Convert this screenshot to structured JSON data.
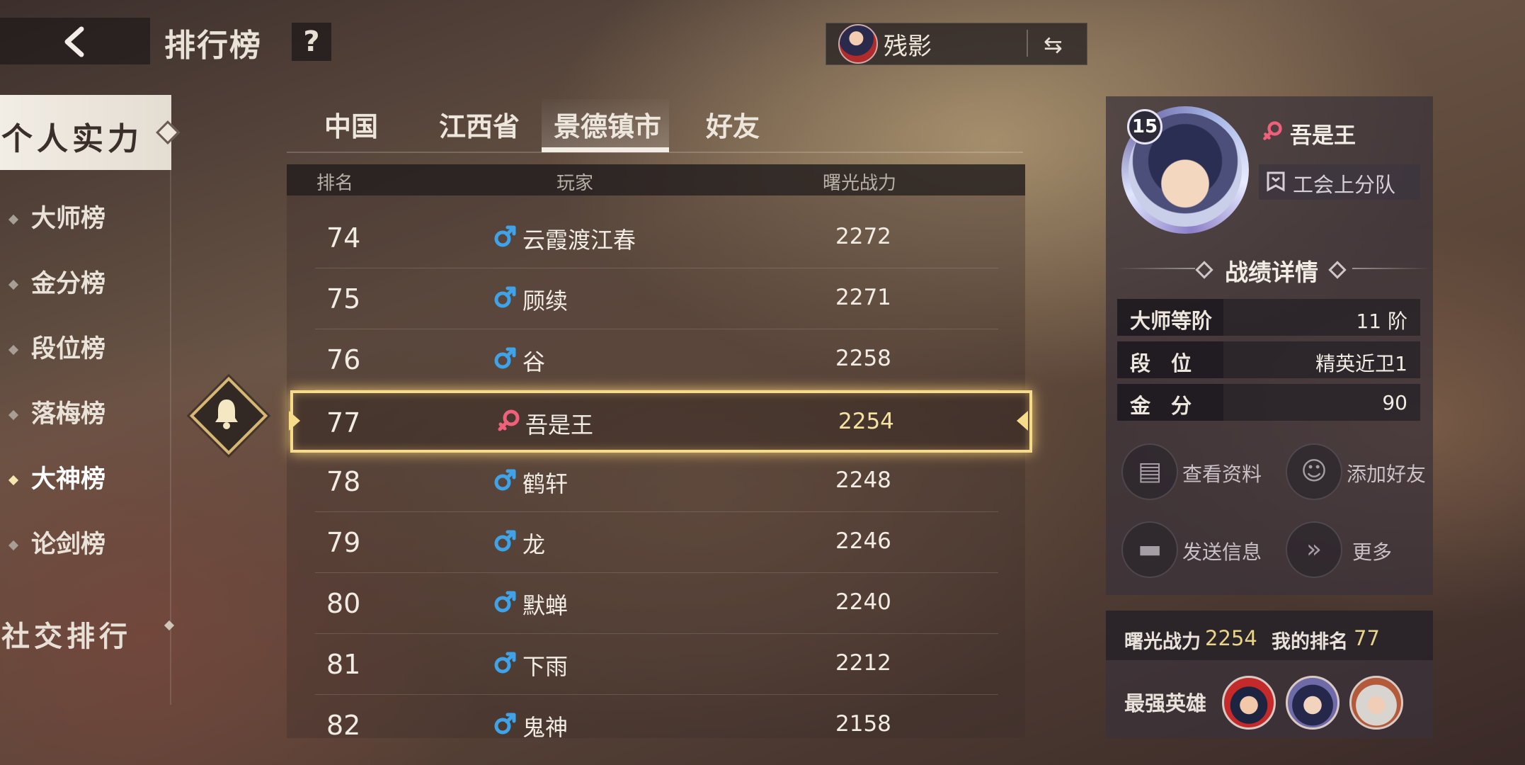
{
  "header": {
    "title": "排行榜",
    "help_label": "?",
    "user_name": "残影",
    "switch_label": "⇆"
  },
  "sidebar": {
    "section_personal": "个人实力",
    "items": [
      {
        "label": "大师榜",
        "active": false
      },
      {
        "label": "金分榜",
        "active": false
      },
      {
        "label": "段位榜",
        "active": false
      },
      {
        "label": "落梅榜",
        "active": false
      },
      {
        "label": "大神榜",
        "active": true
      },
      {
        "label": "论剑榜",
        "active": false
      }
    ],
    "section_social": "社交排行"
  },
  "tabs": [
    {
      "label": "中国",
      "active": false
    },
    {
      "label": "江西省",
      "active": false
    },
    {
      "label": "景德镇市",
      "active": true
    },
    {
      "label": "好友",
      "active": false
    }
  ],
  "table": {
    "headers": {
      "rank": "排名",
      "player": "玩家",
      "power": "曙光战力"
    },
    "rows": [
      {
        "rank": "74",
        "gender": "male",
        "name": "云霞渡江春",
        "power": "2272"
      },
      {
        "rank": "75",
        "gender": "male",
        "name": "顾续",
        "power": "2271"
      },
      {
        "rank": "76",
        "gender": "male",
        "name": "谷",
        "power": "2258"
      },
      {
        "rank": "77",
        "gender": "female",
        "name": "吾是王",
        "power": "2254",
        "highlighted": true
      },
      {
        "rank": "78",
        "gender": "male",
        "name": "鹤轩",
        "power": "2248"
      },
      {
        "rank": "79",
        "gender": "male",
        "name": "龙",
        "power": "2246"
      },
      {
        "rank": "80",
        "gender": "male",
        "name": "默蝉",
        "power": "2240"
      },
      {
        "rank": "81",
        "gender": "male",
        "name": "下雨",
        "power": "2212"
      },
      {
        "rank": "82",
        "gender": "male",
        "name": "鬼神",
        "power": "2158"
      }
    ]
  },
  "profile": {
    "level": "15",
    "name": "吾是王",
    "guild": "工会上分队",
    "detail_title": "战绩详情",
    "stats": [
      {
        "key": "大师等阶",
        "value": "11 阶"
      },
      {
        "key": "段　位",
        "value": "精英近卫1"
      },
      {
        "key": "金　分",
        "value": "90"
      }
    ],
    "actions": {
      "view_profile": "查看资料",
      "add_friend": "添加好友",
      "send_message": "发送信息",
      "more": "更多"
    }
  },
  "summary": {
    "power_label": "曙光战力",
    "power_value": "2254",
    "rank_label": "我的排名",
    "rank_value": "77",
    "heroes_label": "最强英雄"
  },
  "colors": {
    "highlight_gold": "#f6dc8a",
    "male_blue": "#3ea3e8",
    "female_pink": "#f0607a"
  }
}
